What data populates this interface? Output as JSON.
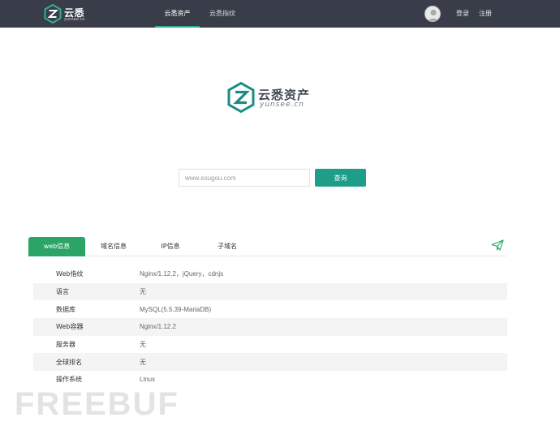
{
  "header": {
    "logo": {
      "name": "云悉",
      "domain": "yunsee.cn"
    },
    "nav": [
      {
        "label": "云悉资产",
        "active": true
      },
      {
        "label": "云悉指纹",
        "active": false
      }
    ],
    "login_label": "登录",
    "register_label": "注册"
  },
  "brand": {
    "name": "云悉资产",
    "domain": "yunsee.cn"
  },
  "search": {
    "placeholder": "www.sougou.com",
    "value": "",
    "button_label": "查询"
  },
  "tabs": [
    {
      "label": "web信息",
      "active": true
    },
    {
      "label": "域名信息",
      "active": false
    },
    {
      "label": "IP信息",
      "active": false
    },
    {
      "label": "子域名",
      "active": false
    }
  ],
  "info": {
    "rows": [
      {
        "key": "Web指纹",
        "value": "Nginx/1.12.2，jQuery，cdnjs"
      },
      {
        "key": "语言",
        "value": "无"
      },
      {
        "key": "数据库",
        "value": "MySQL(5.5.39-MariaDB)"
      },
      {
        "key": "Web容器",
        "value": "Nginx/1.12.2"
      },
      {
        "key": "服务器",
        "value": "无"
      },
      {
        "key": "全球排名",
        "value": "无"
      },
      {
        "key": "操作系统",
        "value": "Linux"
      }
    ]
  },
  "watermark": "FREEBUF",
  "colors": {
    "topbar": "#393d49",
    "nav_active_underline": "#2fb08e",
    "search_button": "#1e9e89",
    "tab_active": "#2aa566",
    "brand_mark": "#1a8c83"
  }
}
